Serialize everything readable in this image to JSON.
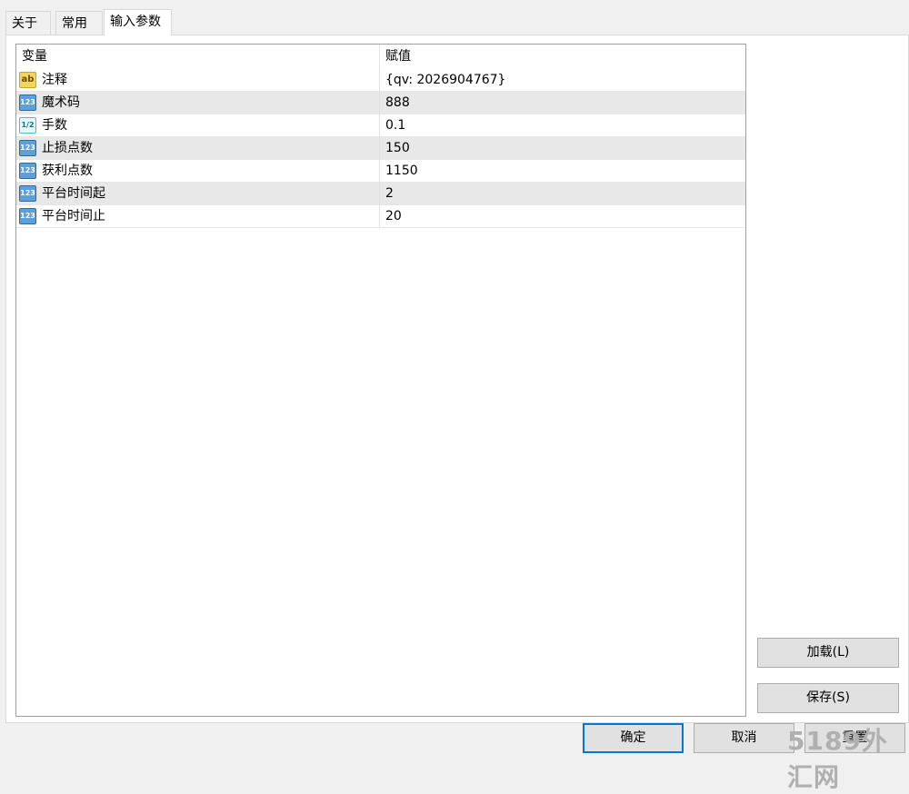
{
  "tabs": [
    {
      "label": "关于"
    },
    {
      "label": "常用"
    },
    {
      "label": "输入参数"
    }
  ],
  "grid": {
    "headers": {
      "name": "变量",
      "value": "赋值"
    },
    "rows": [
      {
        "icon": "ab",
        "name": "注释",
        "value": "{qv: 2026904767}"
      },
      {
        "icon": "123",
        "name": "魔术码",
        "value": "888"
      },
      {
        "icon": "1/2",
        "name": "手数",
        "value": "0.1"
      },
      {
        "icon": "123",
        "name": "止损点数",
        "value": "150"
      },
      {
        "icon": "123",
        "name": "获利点数",
        "value": "1150"
      },
      {
        "icon": "123",
        "name": "平台时间起",
        "value": "2"
      },
      {
        "icon": "123",
        "name": "平台时间止",
        "value": "20"
      }
    ]
  },
  "side_buttons": {
    "load": "加载(L)",
    "save": "保存(S)"
  },
  "footer_buttons": {
    "ok": "确定",
    "cancel": "取消",
    "reset": "重置"
  },
  "watermark": "5189外汇网"
}
